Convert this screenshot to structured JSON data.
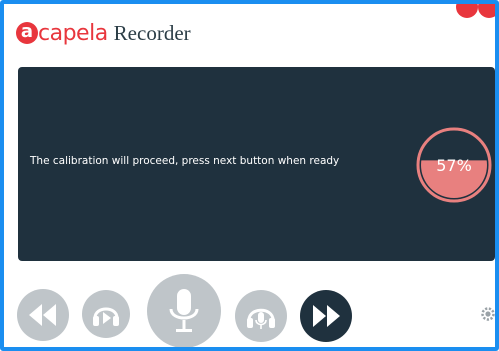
{
  "app": {
    "logo_mark": "a",
    "logo_text": "capela",
    "product": "Recorder"
  },
  "stage": {
    "message": "The calibration will proceed, press next button when ready",
    "progress_label": "57%",
    "progress_fraction": 0.57
  },
  "colors": {
    "brand_red": "#e8363d",
    "panel_dark": "#1f313e",
    "window_border": "#1a8ef0",
    "button_gray": "#bfc5c9",
    "progress_fill": "#e8807f"
  },
  "icons": {
    "rewind": "rewind-icon",
    "play_back": "headphones-play-icon",
    "record": "microphone-icon",
    "play_recording": "headphones-mic-icon",
    "next": "fast-forward-icon",
    "settings": "gear-icon"
  }
}
